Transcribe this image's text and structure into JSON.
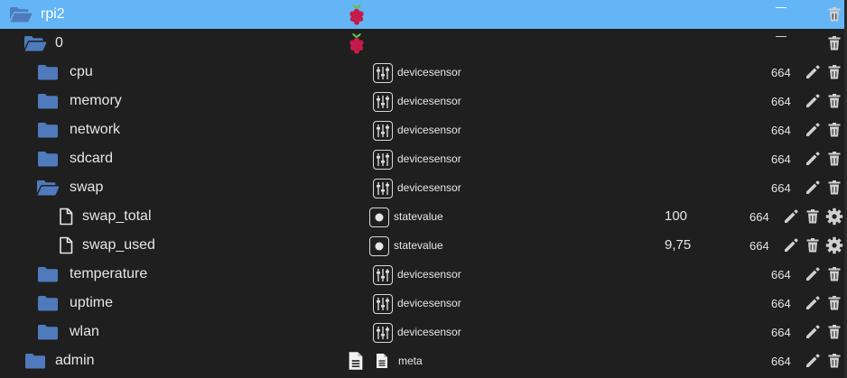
{
  "colors": {
    "background": "#1f1f1f",
    "selected_row": "#64b5f6",
    "folder": "#4f7bbd",
    "icon_gray": "#d0d0d0"
  },
  "rows": [
    {
      "name": "rpi2",
      "icon": "folder-open-icon",
      "type_icon": "raspberry-pi-icon",
      "type_label": "",
      "value": "",
      "perm": "",
      "actions": [
        "collapse-dash",
        "delete"
      ]
    },
    {
      "name": "0",
      "icon": "folder-open-icon",
      "type_icon": "raspberry-pi-icon",
      "type_label": "",
      "value": "",
      "perm": "",
      "actions": [
        "collapse-dash",
        "delete"
      ]
    },
    {
      "name": "cpu",
      "icon": "folder-icon",
      "type_icon": "devicesensor-icon",
      "type_label": "devicesensor",
      "value": "",
      "perm": "664",
      "actions": [
        "edit",
        "delete"
      ]
    },
    {
      "name": "memory",
      "icon": "folder-icon",
      "type_icon": "devicesensor-icon",
      "type_label": "devicesensor",
      "value": "",
      "perm": "664",
      "actions": [
        "edit",
        "delete"
      ]
    },
    {
      "name": "network",
      "icon": "folder-icon",
      "type_icon": "devicesensor-icon",
      "type_label": "devicesensor",
      "value": "",
      "perm": "664",
      "actions": [
        "edit",
        "delete"
      ]
    },
    {
      "name": "sdcard",
      "icon": "folder-icon",
      "type_icon": "devicesensor-icon",
      "type_label": "devicesensor",
      "value": "",
      "perm": "664",
      "actions": [
        "edit",
        "delete"
      ]
    },
    {
      "name": "swap",
      "icon": "folder-open-icon",
      "type_icon": "devicesensor-icon",
      "type_label": "devicesensor",
      "value": "",
      "perm": "664",
      "actions": [
        "edit",
        "delete"
      ]
    },
    {
      "name": "swap_total",
      "icon": "file-icon",
      "type_icon": "statevalue-icon",
      "type_label": "statevalue",
      "value": "100",
      "perm": "664",
      "actions": [
        "edit",
        "delete",
        "settings"
      ]
    },
    {
      "name": "swap_used",
      "icon": "file-icon",
      "type_icon": "statevalue-icon",
      "type_label": "statevalue",
      "value": "9,75",
      "perm": "664",
      "actions": [
        "edit",
        "delete",
        "settings"
      ]
    },
    {
      "name": "temperature",
      "icon": "folder-icon",
      "type_icon": "devicesensor-icon",
      "type_label": "devicesensor",
      "value": "",
      "perm": "664",
      "actions": [
        "edit",
        "delete"
      ]
    },
    {
      "name": "uptime",
      "icon": "folder-icon",
      "type_icon": "devicesensor-icon",
      "type_label": "devicesensor",
      "value": "",
      "perm": "664",
      "actions": [
        "edit",
        "delete"
      ]
    },
    {
      "name": "wlan",
      "icon": "folder-icon",
      "type_icon": "devicesensor-icon",
      "type_label": "devicesensor",
      "value": "",
      "perm": "664",
      "actions": [
        "edit",
        "delete"
      ]
    },
    {
      "name": "admin",
      "icon": "folder-icon",
      "type_icon": "meta-icon",
      "type_label": "meta",
      "value": "",
      "perm": "664",
      "actions": [
        "edit",
        "delete"
      ]
    }
  ]
}
